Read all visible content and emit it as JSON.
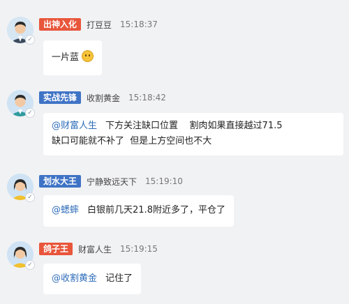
{
  "messages": [
    {
      "tag": "出神入化",
      "tag_color": "#e8563b",
      "username": "打豆豆",
      "time": "15:18:37",
      "mention": "",
      "text": "一片蓝",
      "emoji": "thinking-face",
      "avatar": "male-suit"
    },
    {
      "tag": "实战先锋",
      "tag_color": "#3f73c5",
      "username": "收割黄金",
      "time": "15:18:42",
      "mention": "@财富人生",
      "text_line1": "下方关注缺口位置    割肉如果直接越过71.5",
      "text_line2": "缺口可能就不补了  但是上方空间也不大",
      "avatar": "male-teal"
    },
    {
      "tag": "划水大王",
      "tag_color": "#3f73c5",
      "username": "宁静致远天下",
      "time": "15:19:10",
      "mention": "@蟋蟀",
      "text": "白银前几天21.8附近多了，平仓了",
      "avatar": "female-yellow"
    },
    {
      "tag": "鸽子王",
      "tag_color": "#e8563b",
      "username": "财富人生",
      "time": "15:19:15",
      "mention": "@收割黄金",
      "text": "记住了",
      "avatar": "female-yellow"
    }
  ]
}
